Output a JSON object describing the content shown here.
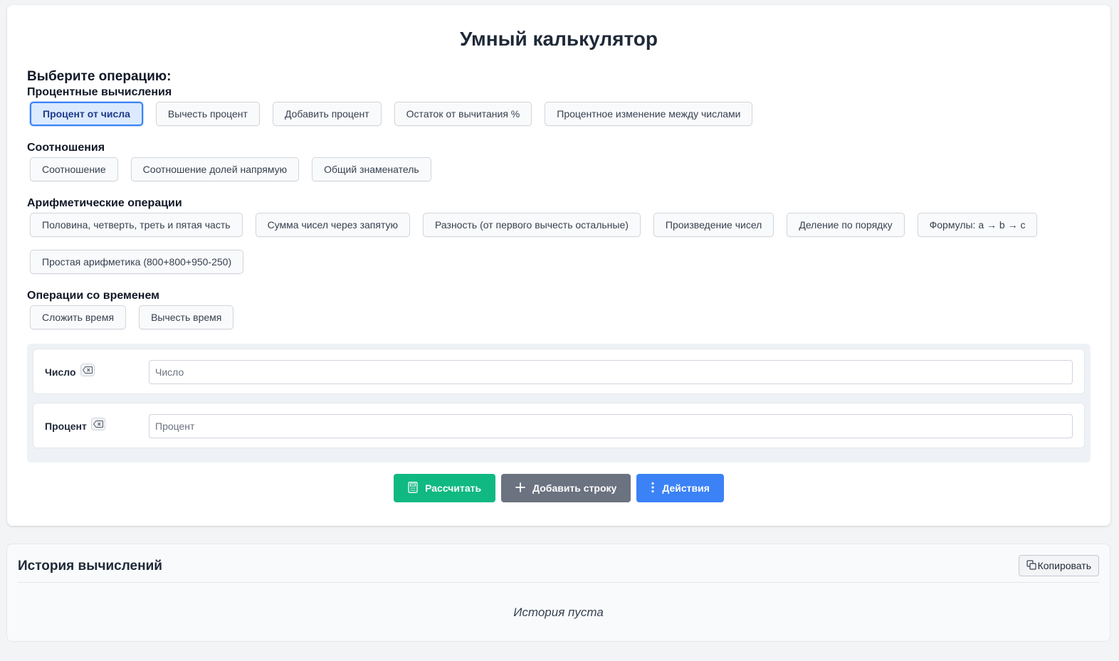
{
  "calculator": {
    "title": "Умный калькулятор",
    "choose_label": "Выберите операцию:",
    "groups": {
      "percent": {
        "title": "Процентные вычисления",
        "ops": [
          "Процент от числа",
          "Вычесть процент",
          "Добавить процент",
          "Остаток от вычитания %",
          "Процентное изменение между числами"
        ],
        "active_index": 0
      },
      "ratios": {
        "title": "Соотношения",
        "ops": [
          "Соотношение",
          "Соотношение долей напрямую",
          "Общий знаменатель"
        ]
      },
      "arithmetic": {
        "title": "Арифметические операции",
        "ops": [
          "Половина, четверть, треть и пятая часть",
          "Сумма чисел через запятую",
          "Разность (от первого вычесть остальные)",
          "Произведение чисел",
          "Деление по порядку",
          "Формулы: a → b → c",
          "Простая арифметика (800+800+950-250)"
        ]
      },
      "time": {
        "title": "Операции со временем",
        "ops": [
          "Сложить время",
          "Вычесть время"
        ]
      }
    },
    "inputs": [
      {
        "label": "Число",
        "placeholder": "Число",
        "value": ""
      },
      {
        "label": "Процент",
        "placeholder": "Процент",
        "value": ""
      }
    ],
    "actions": {
      "calculate": "Рассчитать",
      "add_row": "Добавить строку",
      "more": "Действия"
    }
  },
  "history": {
    "title": "История вычислений",
    "copy_label": "Копировать",
    "empty_text": "История пуста"
  },
  "icons": {
    "clear": "backspace-icon",
    "calculate": "calculator-icon",
    "add": "plus-icon",
    "more": "more-vertical-icon",
    "copy": "copy-icon"
  },
  "colors": {
    "calculate": "#10b981",
    "add_row": "#6b7280",
    "actions": "#3b82f6",
    "active_op_bg": "#dbeafe",
    "active_op_border": "#3b82f6"
  }
}
